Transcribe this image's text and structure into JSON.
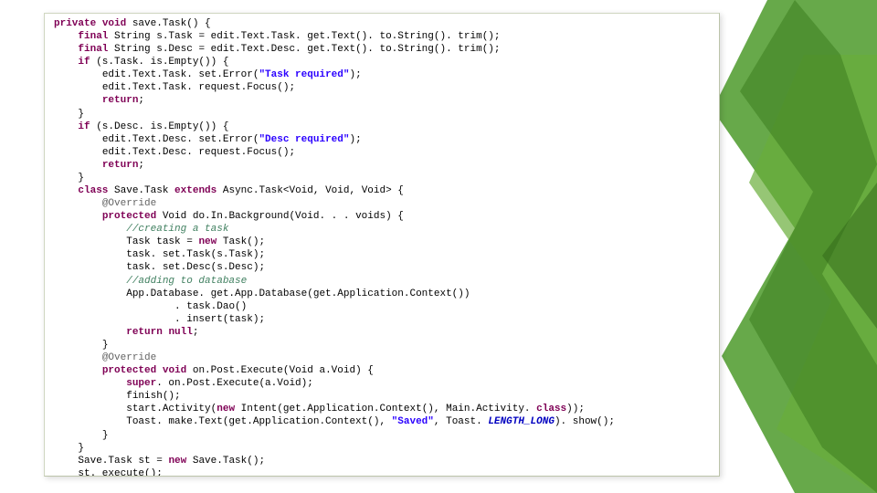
{
  "code": {
    "kw_private": "private",
    "kw_void": "void",
    "kw_final": "final",
    "kw_if": "if",
    "kw_return": "return",
    "kw_class": "class",
    "kw_extends": "extends",
    "kw_protected": "protected",
    "kw_new": "new",
    "kw_null": "null",
    "kw_super": "super",
    "kw_this_class": "class",
    "t_String": "String",
    "t_Void_cap": "Void",
    "t_void": "void",
    "m_saveTask_sig": " save.Task() {",
    "m_sTask_decl": " String s.Task = edit.Text.Task. get.Text(). to.String(). trim();",
    "m_sDesc_decl": " String s.Desc = edit.Text.Desc. get.Text(). to.String(). trim();",
    "m_if_task": " (s.Task. is.Empty()) {",
    "m_task_err1": "edit.Text.Task. set.Error(",
    "m_task_err_str": "\"Task required\"",
    "m_task_err2": ");",
    "m_task_focus": "edit.Text.Task. request.Focus();",
    "m_return_semi": ";",
    "m_brace_close": "}",
    "m_if_desc": " (s.Desc. is.Empty()) {",
    "m_desc_err1": "edit.Text.Desc. set.Error(",
    "m_desc_err_str": "\"Desc required\"",
    "m_desc_err2": ");",
    "m_desc_focus": "edit.Text.Desc. request.Focus();",
    "m_class_decl1": " Save.Task ",
    "m_class_decl2": " Async.Task<Void, Void, Void> {",
    "m_override": "@Override",
    "m_doinbg_sig": " Void do.In.Background(Void. . . voids) {",
    "m_cmt_create": "//creating a task",
    "m_task_new1": "Task task = ",
    "m_task_new2": " Task();",
    "m_settask": "task. set.Task(s.Task);",
    "m_setdesc": "task. set.Desc(s.Desc);",
    "m_cmt_add": "//adding to database",
    "m_appdb": "App.Database. get.App.Database(get.Application.Context())",
    "m_taskdao": ". task.Dao()",
    "m_insert": ". insert(task);",
    "m_return_null": " ",
    "m_onpost_sig": " on.Post.Execute(Void a.Void) {",
    "m_super_call": ". on.Post.Execute(a.Void);",
    "m_finish": "finish();",
    "m_start1": "start.Activity(",
    "m_start2": " Intent(get.Application.Context(), Main.Activity. ",
    "m_start3": "));",
    "m_toast1": "Toast. make.Text(get.Application.Context(), ",
    "m_toast_str": "\"Saved\"",
    "m_toast2": ", Toast. ",
    "m_length_long": "LENGTH_LONG",
    "m_toast3": "). show();",
    "m_st_decl1": "Save.Task st = ",
    "m_st_decl2": " Save.Task();",
    "m_st_exec": "st. execute();"
  }
}
